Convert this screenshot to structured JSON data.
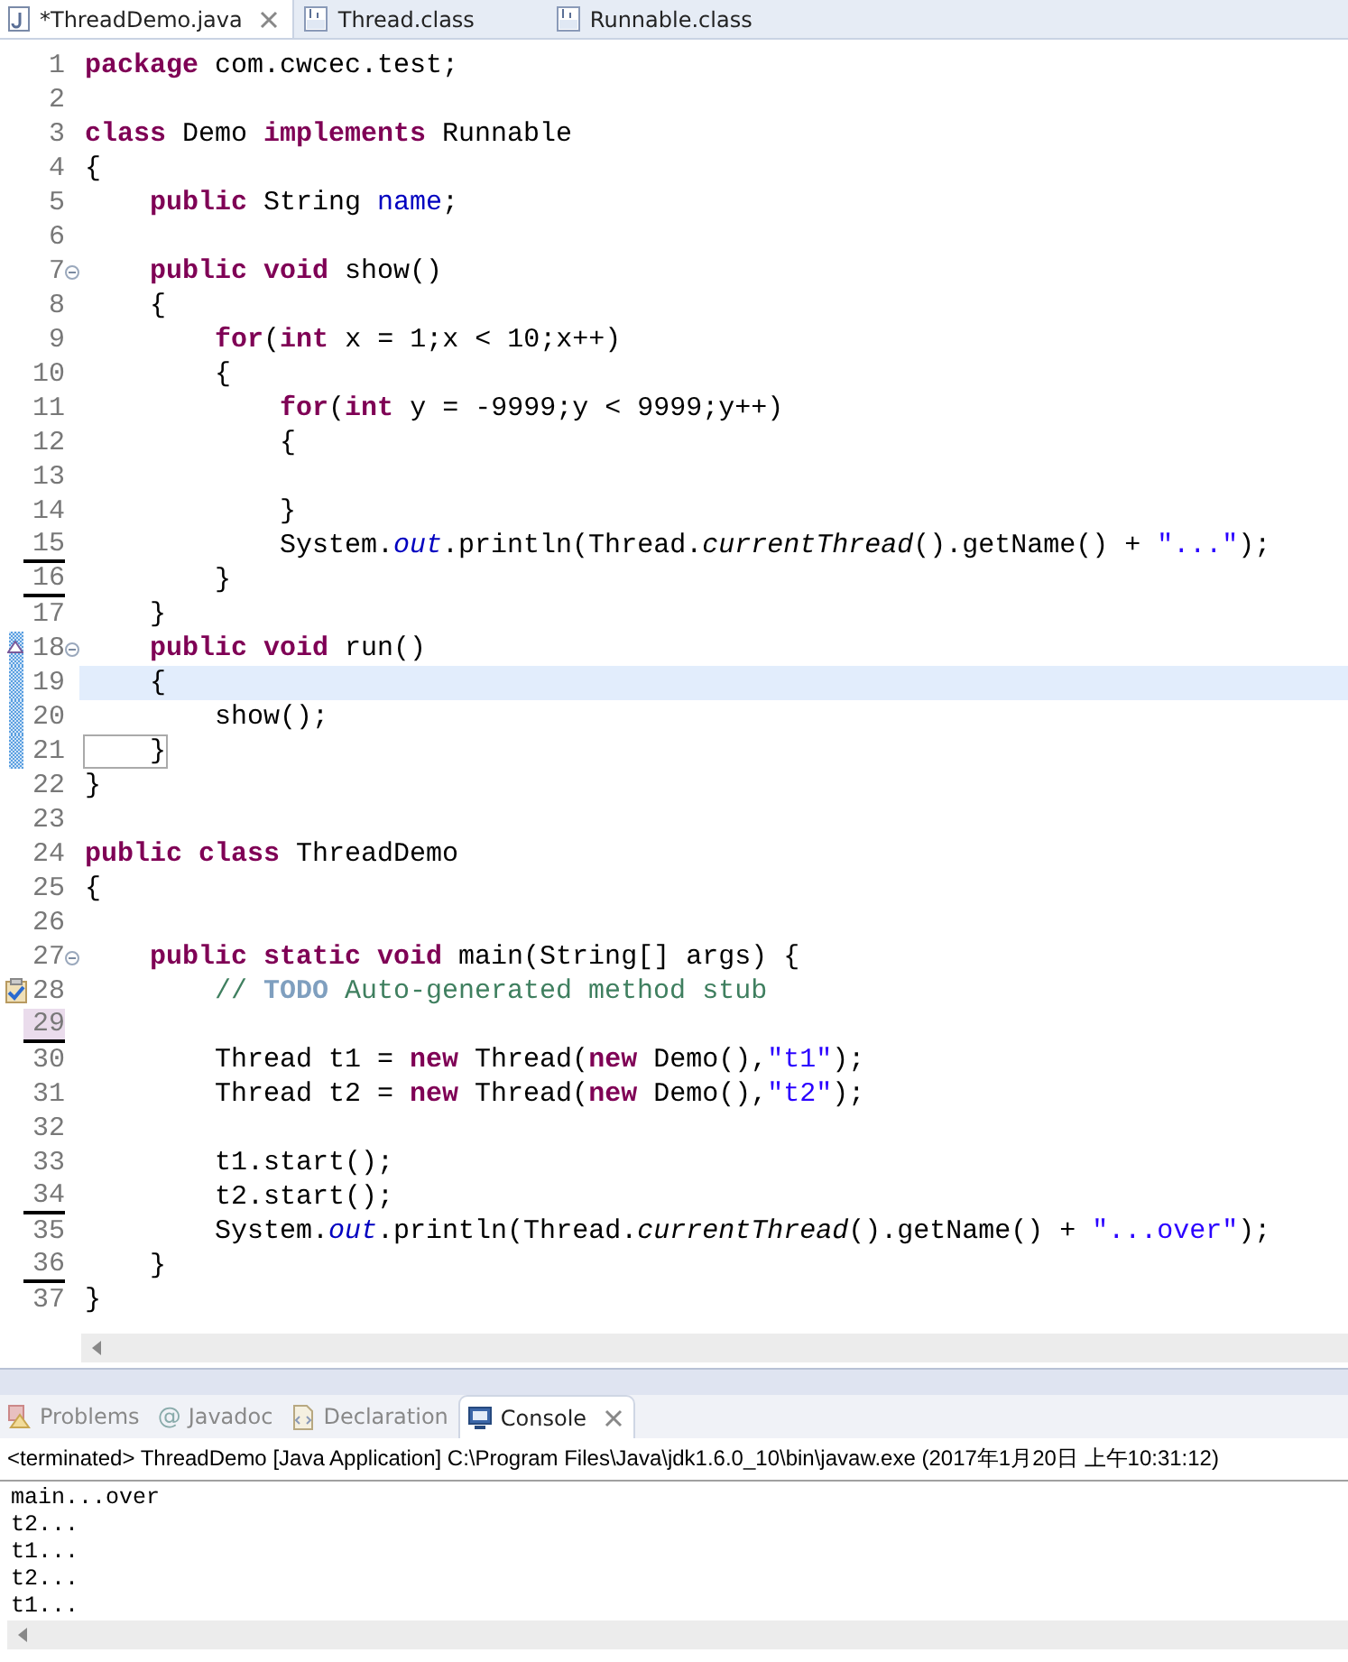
{
  "editor_tabs": [
    {
      "label": "*ThreadDemo.java",
      "kind": "java",
      "selected": true,
      "closable": true
    },
    {
      "label": "Thread.class",
      "kind": "class",
      "selected": false,
      "closable": false
    },
    {
      "label": "Runnable.class",
      "kind": "class",
      "selected": false,
      "closable": false
    }
  ],
  "code_lines": [
    {
      "number": "1",
      "current": false,
      "tokens": [
        {
          "kind": "kw",
          "text": "package"
        },
        {
          "kind": "plain",
          "text": " com.cwcec.test;"
        }
      ]
    },
    {
      "number": "2",
      "current": false
    },
    {
      "number": "3",
      "current": false,
      "tokens": [
        {
          "kind": "kw",
          "text": "class"
        },
        {
          "kind": "plain",
          "text": " Demo "
        },
        {
          "kind": "kw",
          "text": "implements"
        },
        {
          "kind": "plain",
          "text": " Runnable"
        }
      ]
    },
    {
      "number": "4",
      "current": false,
      "tokens": [
        {
          "kind": "plain",
          "text": "{"
        }
      ]
    },
    {
      "number": "5",
      "current": false,
      "tokens": [
        {
          "kind": "kw",
          "text": "    public"
        },
        {
          "kind": "plain",
          "text": " String "
        },
        {
          "kind": "field",
          "text": "name"
        },
        {
          "kind": "plain",
          "text": ";"
        }
      ]
    },
    {
      "number": "6",
      "current": false
    },
    {
      "number": "7",
      "current": false,
      "markers": [
        {
          "kind": "fold"
        }
      ],
      "tokens": [
        {
          "kind": "kw",
          "text": "    public void"
        },
        {
          "kind": "plain",
          "text": " show()"
        }
      ]
    },
    {
      "number": "8",
      "current": false,
      "tokens": [
        {
          "kind": "plain",
          "text": "    {"
        }
      ]
    },
    {
      "number": "9",
      "current": false,
      "tokens": [
        {
          "kind": "kw",
          "text": "        for"
        },
        {
          "kind": "plain",
          "text": "("
        },
        {
          "kind": "kw",
          "text": "int"
        },
        {
          "kind": "plain",
          "text": " x = 1;x < 10;x++)"
        }
      ]
    },
    {
      "number": "10",
      "current": false,
      "tokens": [
        {
          "kind": "plain",
          "text": "        {"
        }
      ]
    },
    {
      "number": "11",
      "current": false,
      "tokens": [
        {
          "kind": "kw",
          "text": "            for"
        },
        {
          "kind": "plain",
          "text": "("
        },
        {
          "kind": "kw",
          "text": "int"
        },
        {
          "kind": "plain",
          "text": " y = -9999;y < 9999;y++)"
        }
      ]
    },
    {
      "number": "12",
      "current": false,
      "tokens": [
        {
          "kind": "plain",
          "text": "            {"
        }
      ]
    },
    {
      "number": "13",
      "current": false
    },
    {
      "number": "14",
      "current": false,
      "tokens": [
        {
          "kind": "plain",
          "text": "            }"
        }
      ]
    },
    {
      "number": "15",
      "current": false,
      "markers": [
        {
          "kind": "underline"
        }
      ],
      "tokens": [
        {
          "kind": "plain",
          "text": "            System."
        },
        {
          "kind": "static",
          "text": "out"
        },
        {
          "kind": "plain",
          "text": ".println(Thread."
        },
        {
          "kind": "method",
          "text": "currentThread"
        },
        {
          "kind": "plain",
          "text": "().getName() + "
        },
        {
          "kind": "string",
          "text": "\"...\""
        },
        {
          "kind": "plain",
          "text": ");"
        }
      ]
    },
    {
      "number": "16",
      "current": false,
      "markers": [
        {
          "kind": "underline"
        }
      ],
      "tokens": [
        {
          "kind": "plain",
          "text": "        }"
        }
      ]
    },
    {
      "number": "17",
      "current": false,
      "tokens": [
        {
          "kind": "plain",
          "text": "    }"
        }
      ]
    },
    {
      "number": "18",
      "current": false,
      "markers": [
        {
          "kind": "change"
        },
        {
          "kind": "override"
        },
        {
          "kind": "fold"
        }
      ],
      "tokens": [
        {
          "kind": "kw",
          "text": "    public void"
        },
        {
          "kind": "plain",
          "text": " run()"
        }
      ]
    },
    {
      "number": "19",
      "current": true,
      "markers": [
        {
          "kind": "change"
        }
      ],
      "tokens": [
        {
          "kind": "plain",
          "text": "    {"
        }
      ]
    },
    {
      "number": "20",
      "current": false,
      "markers": [
        {
          "kind": "change"
        }
      ],
      "tokens": [
        {
          "kind": "plain",
          "text": "        show();"
        }
      ]
    },
    {
      "number": "21",
      "current": false,
      "markers": [
        {
          "kind": "change"
        }
      ],
      "tokens": [
        {
          "kind": "bracket",
          "text": "    }"
        }
      ]
    },
    {
      "number": "22",
      "current": false,
      "tokens": [
        {
          "kind": "plain",
          "text": "}"
        }
      ]
    },
    {
      "number": "23",
      "current": false
    },
    {
      "number": "24",
      "current": false,
      "tokens": [
        {
          "kind": "kw",
          "text": "public class"
        },
        {
          "kind": "plain",
          "text": " ThreadDemo"
        }
      ]
    },
    {
      "number": "25",
      "current": false,
      "tokens": [
        {
          "kind": "plain",
          "text": "{"
        }
      ]
    },
    {
      "number": "26",
      "current": false
    },
    {
      "number": "27",
      "current": false,
      "markers": [
        {
          "kind": "fold"
        }
      ],
      "tokens": [
        {
          "kind": "kw",
          "text": "    public static void"
        },
        {
          "kind": "plain",
          "text": " main(String[] args) {"
        }
      ]
    },
    {
      "number": "28",
      "current": false,
      "markers": [
        {
          "kind": "task"
        }
      ],
      "tokens": [
        {
          "kind": "comment",
          "text": "        //"
        },
        {
          "kind": "todo",
          "text": " TODO"
        },
        {
          "kind": "comment",
          "text": " Auto-generated method stub"
        }
      ]
    },
    {
      "number": "29",
      "current": false,
      "markers": [
        {
          "kind": "underline"
        },
        {
          "kind": "highlight"
        }
      ]
    },
    {
      "number": "30",
      "current": false,
      "tokens": [
        {
          "kind": "plain",
          "text": "        Thread t1 = "
        },
        {
          "kind": "kw",
          "text": "new"
        },
        {
          "kind": "plain",
          "text": " Thread("
        },
        {
          "kind": "kw",
          "text": "new"
        },
        {
          "kind": "plain",
          "text": " Demo(),"
        },
        {
          "kind": "string",
          "text": "\"t1\""
        },
        {
          "kind": "plain",
          "text": ");"
        }
      ]
    },
    {
      "number": "31",
      "current": false,
      "tokens": [
        {
          "kind": "plain",
          "text": "        Thread t2 = "
        },
        {
          "kind": "kw",
          "text": "new"
        },
        {
          "kind": "plain",
          "text": " Thread("
        },
        {
          "kind": "kw",
          "text": "new"
        },
        {
          "kind": "plain",
          "text": " Demo(),"
        },
        {
          "kind": "string",
          "text": "\"t2\""
        },
        {
          "kind": "plain",
          "text": ");"
        }
      ]
    },
    {
      "number": "32",
      "current": false
    },
    {
      "number": "33",
      "current": false,
      "tokens": [
        {
          "kind": "plain",
          "text": "        t1.start();"
        }
      ]
    },
    {
      "number": "34",
      "current": false,
      "markers": [
        {
          "kind": "underline"
        }
      ],
      "tokens": [
        {
          "kind": "plain",
          "text": "        t2.start();"
        }
      ]
    },
    {
      "number": "35",
      "current": false,
      "tokens": [
        {
          "kind": "plain",
          "text": "        System."
        },
        {
          "kind": "static",
          "text": "out"
        },
        {
          "kind": "plain",
          "text": ".println(Thread."
        },
        {
          "kind": "method",
          "text": "currentThread"
        },
        {
          "kind": "plain",
          "text": "().getName() + "
        },
        {
          "kind": "string",
          "text": "\"...over\""
        },
        {
          "kind": "plain",
          "text": ");"
        }
      ]
    },
    {
      "number": "36",
      "current": false,
      "markers": [
        {
          "kind": "underline"
        }
      ],
      "tokens": [
        {
          "kind": "plain",
          "text": "    }"
        }
      ]
    },
    {
      "number": "37",
      "current": false,
      "tokens": [
        {
          "kind": "plain",
          "text": "}"
        }
      ]
    }
  ],
  "panel_tabs": [
    {
      "label": "Problems",
      "kind": "problems",
      "selected": false
    },
    {
      "label": "Javadoc",
      "kind": "javadoc",
      "icon": "@",
      "selected": false
    },
    {
      "label": "Declaration",
      "kind": "declaration",
      "selected": false
    },
    {
      "label": "Console",
      "kind": "console",
      "selected": true
    }
  ],
  "console": {
    "status": "<terminated> ThreadDemo [Java Application] C:\\Program Files\\Java\\jdk1.6.0_10\\bin\\javaw.exe (2017年1月20日 上午10:31:12)",
    "output": [
      "main...over",
      "t2...",
      "t1...",
      "t2...",
      "t1..."
    ]
  }
}
